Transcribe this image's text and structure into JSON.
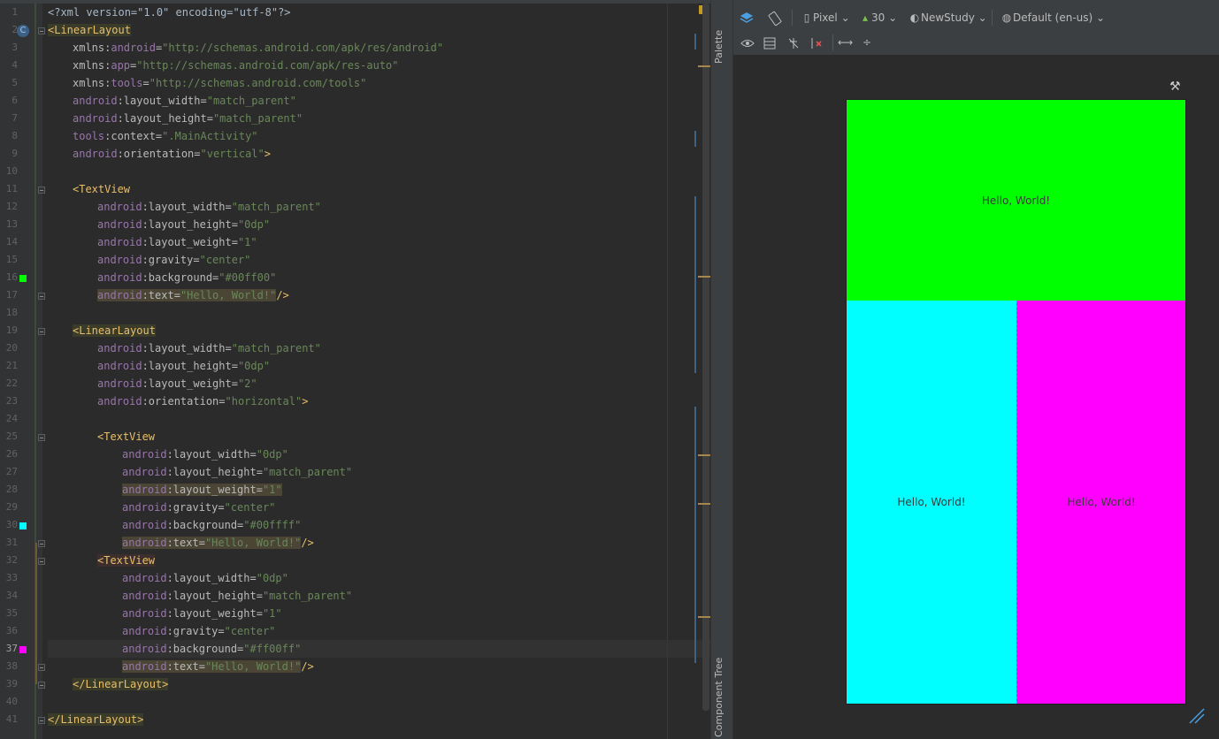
{
  "editor": {
    "line_numbers": [
      "1",
      "2",
      "3",
      "4",
      "5",
      "6",
      "7",
      "8",
      "9",
      "10",
      "11",
      "12",
      "13",
      "14",
      "15",
      "16",
      "17",
      "18",
      "19",
      "20",
      "21",
      "22",
      "23",
      "24",
      "25",
      "26",
      "27",
      "28",
      "29",
      "30",
      "31",
      "32",
      "33",
      "34",
      "35",
      "36",
      "37",
      "38",
      "39",
      "40",
      "41"
    ],
    "current_line": "37",
    "code": {
      "l1": "<?xml version=\"1.0\" encoding=\"utf-8\"?>",
      "l2_tag": "<LinearLayout",
      "l3_ns": "xmlns:",
      "l3_attr": "android",
      "l3_val": "\"http://schemas.android.com/apk/res/android\"",
      "l4_ns": "xmlns:",
      "l4_attr": "app",
      "l4_val": "\"http://schemas.android.com/apk/res-auto\"",
      "l5_ns": "xmlns:",
      "l5_attr": "tools",
      "l5_val": "\"http://schemas.android.com/tools\"",
      "l6_ns": "android",
      "l6_attr": ":layout_width=",
      "l6_val": "\"match_parent\"",
      "l7_ns": "android",
      "l7_attr": ":layout_height=",
      "l7_val": "\"match_parent\"",
      "l8_ns": "tools",
      "l8_attr": ":context=",
      "l8_val": "\".MainActivity\"",
      "l9_ns": "android",
      "l9_attr": ":orientation=",
      "l9_val": "\"vertical\"",
      "l9_end": ">",
      "l11_tag": "<TextView",
      "l12_ns": "android",
      "l12_attr": ":layout_width=",
      "l12_val": "\"match_parent\"",
      "l13_ns": "android",
      "l13_attr": ":layout_height=",
      "l13_val": "\"0dp\"",
      "l14_ns": "android",
      "l14_attr": ":layout_weight=",
      "l14_val": "\"1\"",
      "l15_ns": "android",
      "l15_attr": ":gravity=",
      "l15_val": "\"center\"",
      "l16_ns": "android",
      "l16_attr": ":background=",
      "l16_val": "\"#00ff00\"",
      "l17_ns": "android",
      "l17_attr": ":text=",
      "l17_val": "\"Hello, World!\"",
      "l17_end": "/>",
      "l19_tag": "<LinearLayout",
      "l20_ns": "android",
      "l20_attr": ":layout_width=",
      "l20_val": "\"match_parent\"",
      "l21_ns": "android",
      "l21_attr": ":layout_height=",
      "l21_val": "\"0dp\"",
      "l22_ns": "android",
      "l22_attr": ":layout_weight=",
      "l22_val": "\"2\"",
      "l23_ns": "android",
      "l23_attr": ":orientation=",
      "l23_val": "\"horizontal\"",
      "l23_end": ">",
      "l25_tag": "<TextView",
      "l26_ns": "android",
      "l26_attr": ":layout_width=",
      "l26_val": "\"0dp\"",
      "l27_ns": "android",
      "l27_attr": ":layout_height=",
      "l27_val": "\"match_parent\"",
      "l28_ns": "android",
      "l28_attr": ":layout_weight=",
      "l28_val": "\"1\"",
      "l29_ns": "android",
      "l29_attr": ":gravity=",
      "l29_val": "\"center\"",
      "l30_ns": "android",
      "l30_attr": ":background=",
      "l30_val": "\"#00ffff\"",
      "l31_ns": "android",
      "l31_attr": ":text=",
      "l31_val": "\"Hello, World!\"",
      "l31_end": "/>",
      "l32_tag": "<TextView",
      "l33_ns": "android",
      "l33_attr": ":layout_width=",
      "l33_val": "\"0dp\"",
      "l34_ns": "android",
      "l34_attr": ":layout_height=",
      "l34_val": "\"match_parent\"",
      "l35_ns": "android",
      "l35_attr": ":layout_weight=",
      "l35_val": "\"1\"",
      "l36_ns": "android",
      "l36_attr": ":gravity=",
      "l36_val": "\"center\"",
      "l37_ns": "android",
      "l37_attr": ":background=",
      "l37_val": "\"#ff00ff\"",
      "l38_ns": "android",
      "l38_attr": ":text=",
      "l38_val": "\"Hello, World!\"",
      "l38_end": "/>",
      "l39_tag": "</LinearLayout>",
      "l41_tag": "</LinearLayout>"
    },
    "swatches": {
      "green": "#00ff00",
      "cyan": "#00ffff",
      "magenta": "#ff00ff"
    }
  },
  "side_tabs": {
    "palette": "Palette",
    "component_tree": "Component Tree"
  },
  "toolbar": {
    "device": "Pixel",
    "api_level": "30",
    "theme": "NewStudy",
    "locale": "Default (en-us)"
  },
  "preview": {
    "top_text": "Hello, World!",
    "left_text": "Hello, World!",
    "right_text": "Hello, World!",
    "top_color": "#00ff00",
    "left_color": "#00ffff",
    "right_color": "#ff00ff"
  }
}
